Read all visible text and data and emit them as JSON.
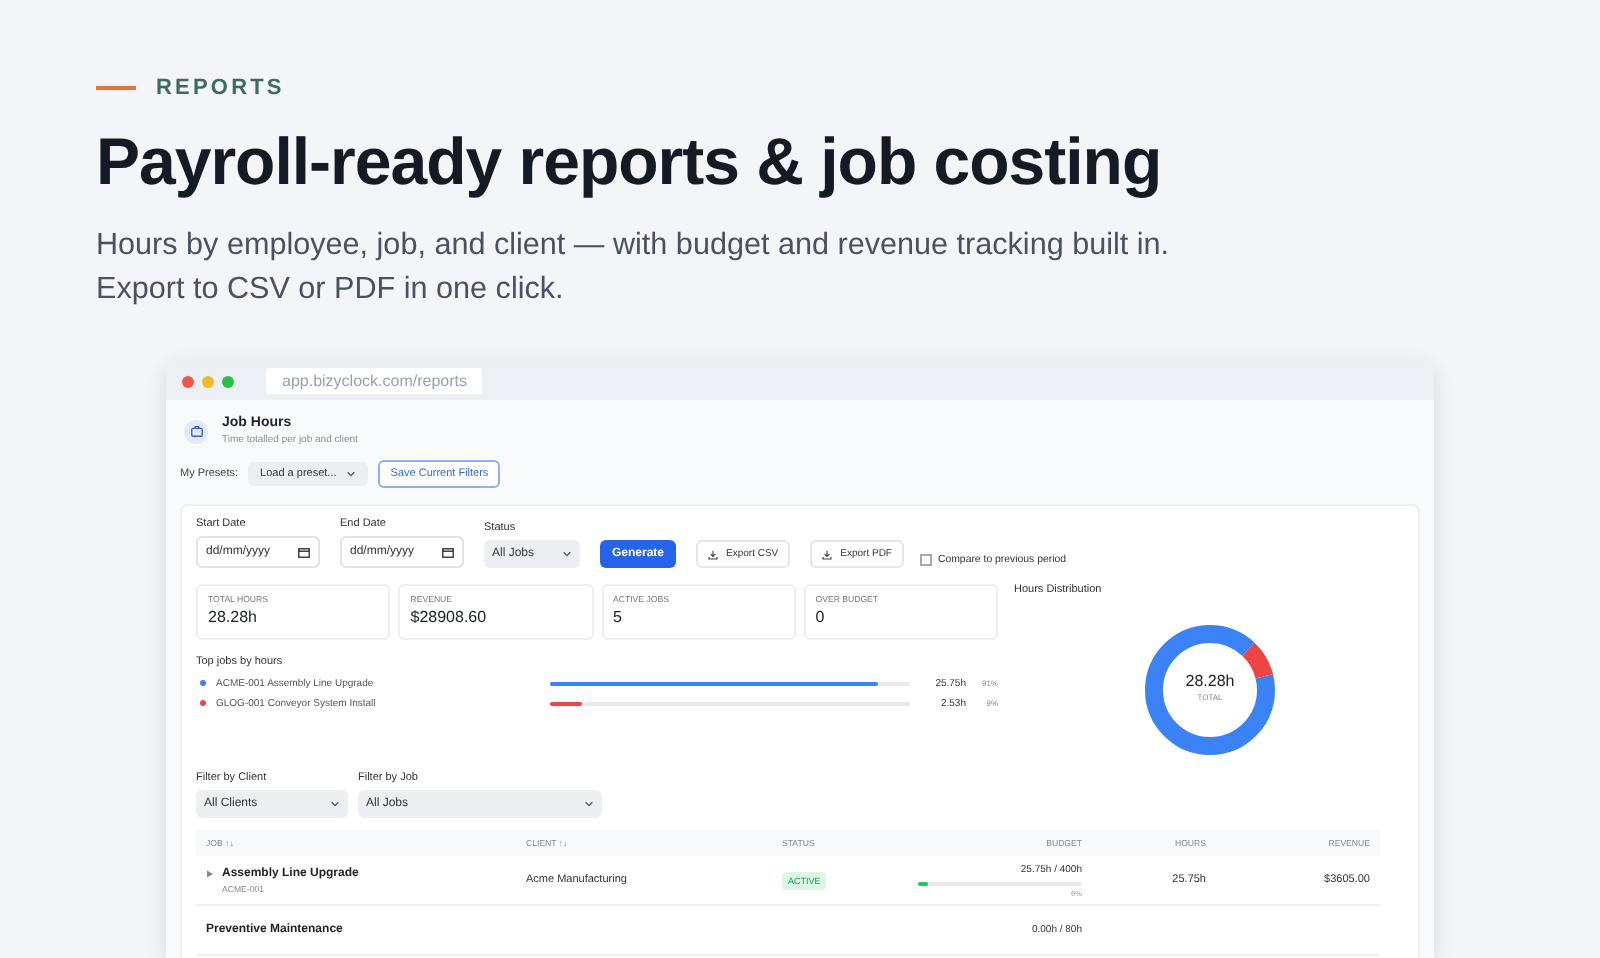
{
  "header": {
    "eyebrow": "REPORTS",
    "title": "Payroll-ready reports & job costing",
    "subtitle": "Hours by employee, job, and client — with budget and revenue tracking built in. Export to CSV or PDF in one click."
  },
  "browser": {
    "url": "app.bizyclock.com/reports"
  },
  "page": {
    "title": "Job Hours",
    "subtitle": "Time totalled per job and client"
  },
  "presets": {
    "label": "My Presets:",
    "select": "Load a preset...",
    "save_button": "Save Current Filters"
  },
  "filters": {
    "start_date": {
      "label": "Start Date",
      "placeholder": "dd/mm/yyyy"
    },
    "end_date": {
      "label": "End Date",
      "placeholder": "dd/mm/yyyy"
    },
    "status": {
      "label": "Status",
      "value": "All Jobs"
    },
    "generate": "Generate",
    "export_csv": "Export CSV",
    "export_pdf": "Export PDF",
    "compare": {
      "label": "Compare to previous period",
      "checked": false
    }
  },
  "stats": [
    {
      "label": "TOTAL HOURS",
      "value": "28.28h"
    },
    {
      "label": "REVENUE",
      "value": "$28908.60"
    },
    {
      "label": "ACTIVE JOBS",
      "value": "5"
    },
    {
      "label": "OVER BUDGET",
      "value": "0"
    }
  ],
  "top_jobs": {
    "title": "Top jobs by hours",
    "items": [
      {
        "name": "ACME-001 Assembly Line Upgrade",
        "color": "#3b82f6",
        "level": 0.91,
        "hours": "25.75h",
        "percent": "91%"
      },
      {
        "name": "GLOG-001 Conveyor System Install",
        "color": "#ef4444",
        "level": 0.09,
        "hours": "2.53h",
        "percent": "9%"
      }
    ]
  },
  "distribution": {
    "title": "Hours Distribution",
    "total": "28.28h",
    "total_label": "TOTAL"
  },
  "table_filters": [
    {
      "label": "Filter by Client",
      "value": "All Clients"
    },
    {
      "label": "Filter by Job",
      "value": "All Jobs"
    }
  ],
  "table": {
    "columns": [
      "JOB ↑↓",
      "CLIENT ↑↓",
      "STATUS",
      "BUDGET",
      "HOURS",
      "REVENUE"
    ],
    "rows": [
      {
        "expandable": true,
        "name": "Assembly Line Upgrade",
        "code": "ACME-001",
        "client": "Acme Manufacturing",
        "status": "ACTIVE",
        "budget": {
          "text": "25.75h / 400h",
          "level": 0.06,
          "percent": "6%"
        },
        "hours": "25.75h",
        "revenue": "$3605.00"
      },
      {
        "name": "Preventive Maintenance",
        "budget": {
          "text": "0.00h / 80h"
        }
      }
    ]
  }
}
